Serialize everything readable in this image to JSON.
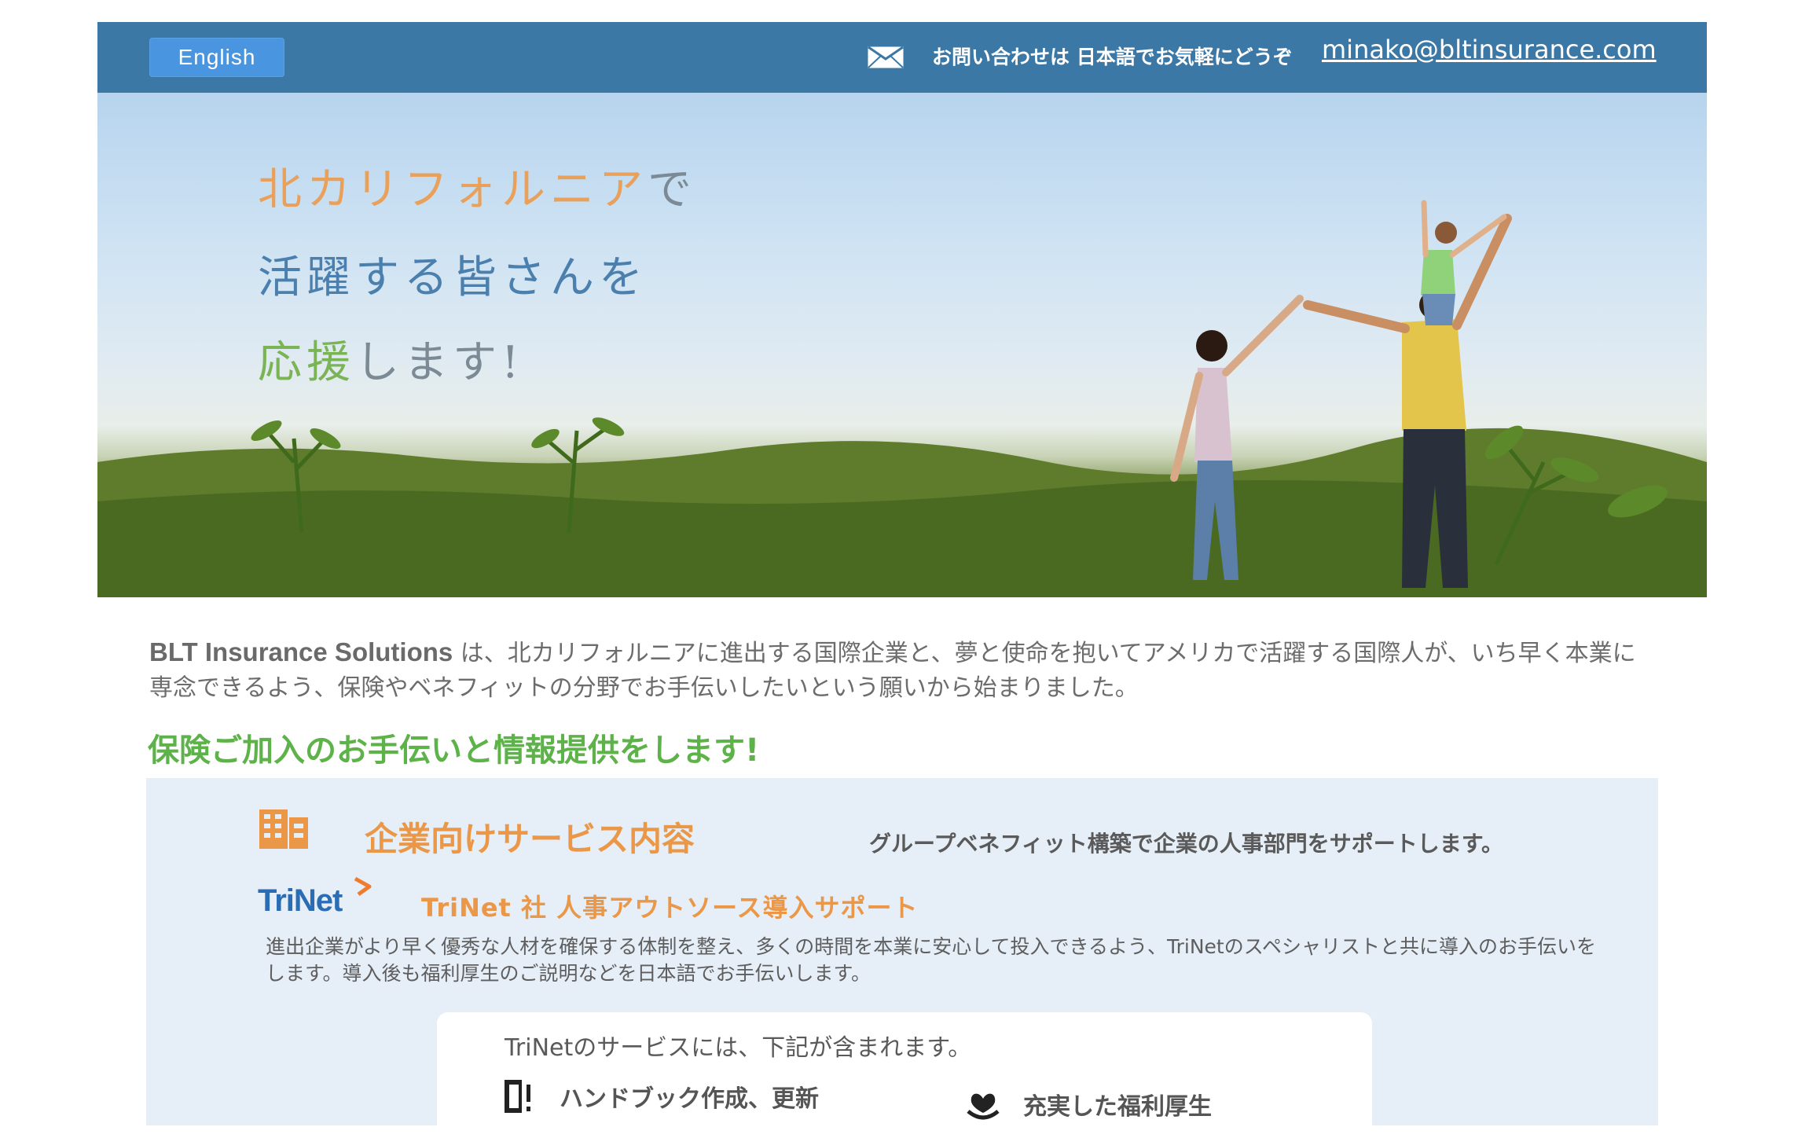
{
  "header": {
    "language_button": "English",
    "mail_icon": "envelope-icon",
    "contact_text": "お問い合わせは 日本語でお気軽にどうぞ",
    "email": "minako@bltinsurance.com"
  },
  "hero": {
    "line1_highlight": "北カリフォルニア",
    "line1_rest": "で",
    "line2_highlight": "活躍",
    "line2_rest": "する皆さんを",
    "line3_highlight": "応援",
    "line3_rest": "します!"
  },
  "intro": {
    "company": "BLT Insurance Solutions",
    "text": " は、北カリフォルニアに進出する国際企業と、夢と使命を抱いてアメリカで活躍する国際人が、いち早く本業に専念できるよう、保険やベネフィットの分野でお手伝いしたいという願いから始まりました。"
  },
  "section_heading": "保険ご加入のお手伝いと情報提供をします!",
  "services": {
    "icon": "building-icon",
    "title": "企業向けサービス内容",
    "description": "グループベネフィット構築で企業の人事部門をサポートします。",
    "trinet": {
      "logo_text": "TriNet",
      "title": "TriNet 社 人事アウトソース導入サポート",
      "description": "進出企業がより早く優秀な人材を確保する体制を整え、多くの時間を本業に安心して投入できるよう、TriNetのスペシャリストと共に導入のお手伝いをします。導入後も福利厚生のご説明などを日本語でお手伝いします。"
    },
    "card": {
      "intro": "TriNetのサービスには、下記が含まれます。",
      "items": [
        {
          "icon": "handbook-icon",
          "label": "ハンドブック作成、更新"
        },
        {
          "icon": "benefits-heart-icon",
          "label": "充実した福利厚生"
        }
      ]
    }
  },
  "colors": {
    "header_bg": "#3b78a6",
    "accent_orange": "#ea9748",
    "accent_green": "#5db34a",
    "panel_bg": "#e6eef7"
  }
}
